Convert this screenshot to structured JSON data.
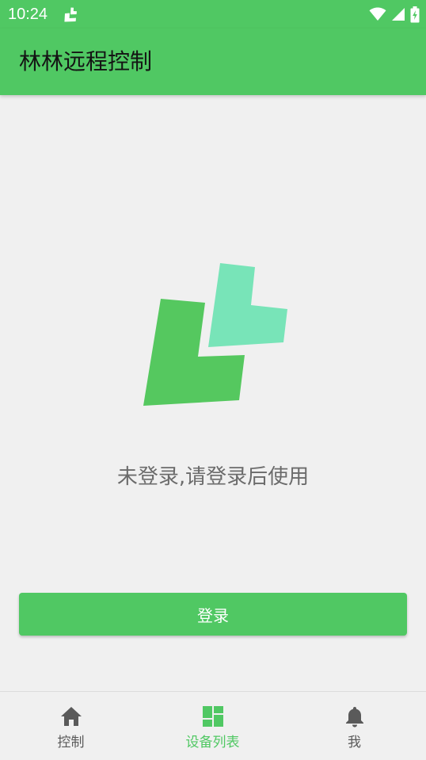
{
  "status_bar": {
    "time": "10:24",
    "notification_icon": "app-notification-icon",
    "wifi_icon": "wifi-icon",
    "signal_icon": "cell-signal-icon",
    "battery_icon": "battery-charging-icon"
  },
  "app_bar": {
    "title": "林林远程控制"
  },
  "main": {
    "logo_icon": "app-logo-icon",
    "message": "未登录,请登录后使用",
    "login_button_label": "登录"
  },
  "bottom_nav": {
    "items": [
      {
        "label": "控制",
        "icon": "home-icon",
        "active": false
      },
      {
        "label": "设备列表",
        "icon": "dashboard-icon",
        "active": true
      },
      {
        "label": "我",
        "icon": "bell-icon",
        "active": false
      }
    ]
  },
  "colors": {
    "primary": "#50c863",
    "logo_green": "#55c85f",
    "logo_mint": "#78e4b8",
    "background": "#f0f0f0",
    "message_text": "#6b6b6b",
    "inactive_nav": "#5a5a5a"
  }
}
